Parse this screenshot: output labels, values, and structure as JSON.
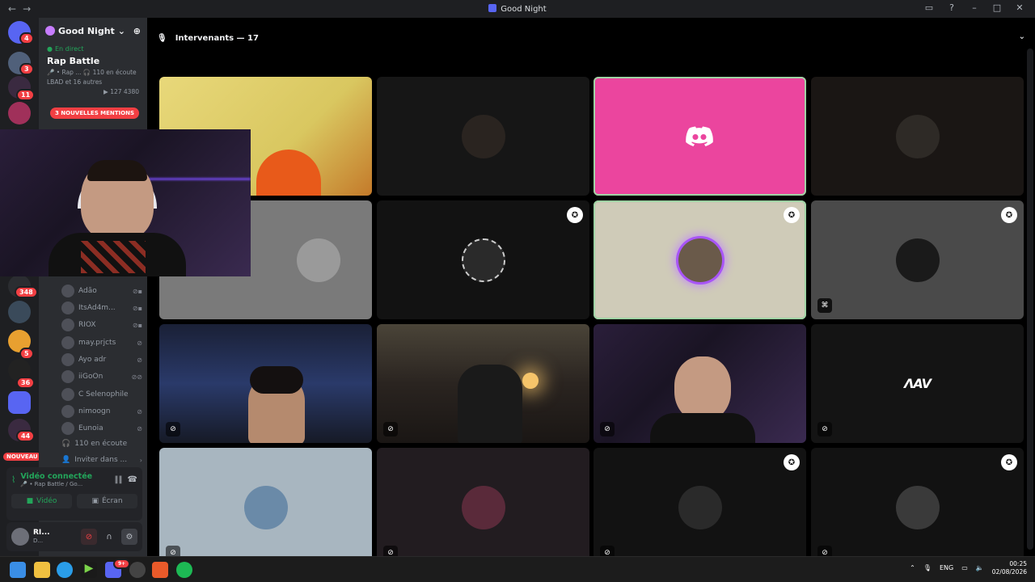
{
  "window": {
    "title": "Good Night"
  },
  "servers": {
    "badges": [
      "4",
      "3",
      "11",
      "348",
      "5",
      "36",
      "44"
    ],
    "new_label": "NOUVEAU"
  },
  "guild": {
    "name": "Good Night"
  },
  "stage": {
    "live_label": "En direct",
    "title": "Rap Battle",
    "meta": "🎤 • Rap ...  🎧 110 en écoute",
    "speakers_line": "LBAD et 16 autres",
    "mentions": "3 NOUVELLES MENTIONS",
    "counts": {
      "video": "127",
      "other": "4380"
    }
  },
  "members": [
    {
      "name": "Adão"
    },
    {
      "name": "ItsAd4m..."
    },
    {
      "name": "RIOX"
    },
    {
      "name": "may.prjcts"
    },
    {
      "name": "Ayo adr"
    },
    {
      "name": "iiGoOn"
    },
    {
      "name": "C Selenophile"
    },
    {
      "name": "nimoogn"
    },
    {
      "name": "Eunoia"
    }
  ],
  "listening": "110 en écoute",
  "invite": "Inviter dans ...",
  "voice": {
    "status": "Vidéo connectée",
    "location": "🎤 • Rap Battle / Go...",
    "video_btn": "Vidéo",
    "screen_btn": "Écran"
  },
  "user": {
    "name": "RI...",
    "status": "D..."
  },
  "main": {
    "header": "Intervenants — 17"
  },
  "taskbar": {
    "lang": "ENG",
    "time": "00:25",
    "date": "02/08/2026",
    "discord_badge": "9+"
  },
  "colors": {
    "discord_pink": "#eb459e",
    "speaking_outline": "#9fd3a4",
    "online_green": "#23a55a",
    "mention_red": "#f23f43"
  }
}
